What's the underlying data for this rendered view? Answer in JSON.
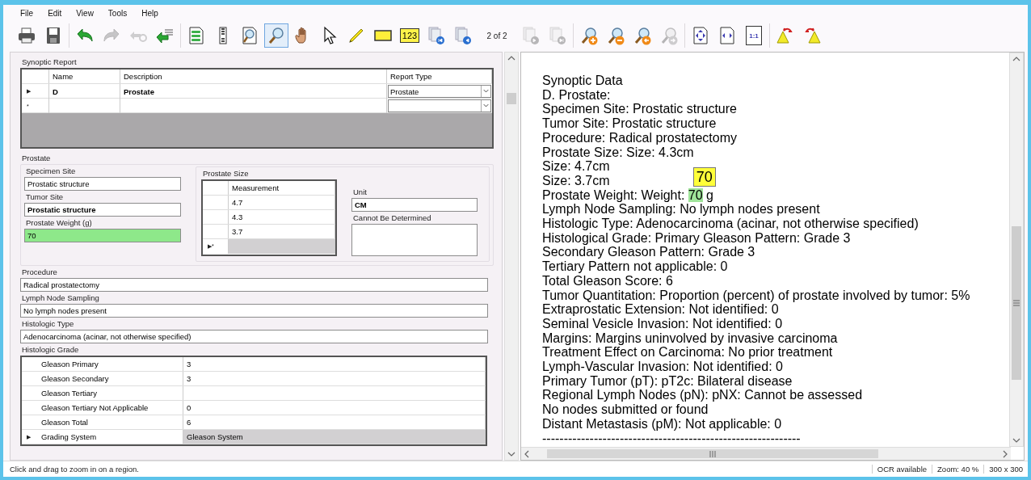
{
  "menu": [
    "File",
    "Edit",
    "View",
    "Tools",
    "Help"
  ],
  "toolbar": {
    "groups": [
      [
        {
          "kind": "print",
          "disabled": false,
          "selected": false
        },
        {
          "kind": "save",
          "disabled": false,
          "selected": false
        }
      ],
      [
        {
          "kind": "undo",
          "disabled": false,
          "selected": false
        },
        {
          "kind": "redo",
          "disabled": true,
          "selected": false
        },
        {
          "kind": "link",
          "disabled": true,
          "selected": false
        },
        {
          "kind": "import",
          "disabled": false,
          "selected": false
        }
      ],
      [
        {
          "kind": "document",
          "disabled": false,
          "selected": false
        },
        {
          "kind": "barcode",
          "disabled": false,
          "selected": false
        },
        {
          "kind": "inspect",
          "disabled": false,
          "selected": false
        },
        {
          "kind": "zoom_tool",
          "disabled": false,
          "selected": true
        },
        {
          "kind": "pan",
          "disabled": false,
          "selected": false
        },
        {
          "kind": "pointer",
          "disabled": false,
          "selected": false
        },
        {
          "kind": "highlighter",
          "disabled": false,
          "selected": false
        },
        {
          "kind": "rectangle",
          "disabled": false,
          "selected": false
        },
        {
          "kind": "number_stamp",
          "label": "123",
          "disabled": false,
          "selected": false
        },
        {
          "kind": "first_page",
          "disabled": false,
          "selected": false
        },
        {
          "kind": "previous_page",
          "disabled": false,
          "selected": false
        },
        {
          "kind": "page_counter",
          "text": "2 of 2"
        },
        {
          "kind": "next_page",
          "disabled": true,
          "selected": false
        },
        {
          "kind": "last_page",
          "disabled": true,
          "selected": false
        }
      ],
      [
        {
          "kind": "zoom_in",
          "disabled": false,
          "selected": false
        },
        {
          "kind": "zoom_out",
          "disabled": false,
          "selected": false
        },
        {
          "kind": "zoom_previous",
          "disabled": false,
          "selected": false
        },
        {
          "kind": "zoom_next",
          "disabled": true,
          "selected": false
        }
      ],
      [
        {
          "kind": "fit_page",
          "disabled": false,
          "selected": false
        },
        {
          "kind": "fit_width",
          "disabled": false,
          "selected": false
        },
        {
          "kind": "actual_size",
          "label": "1:1",
          "disabled": false,
          "selected": false
        }
      ],
      [
        {
          "kind": "rotate_left",
          "disabled": false,
          "selected": false
        },
        {
          "kind": "rotate_right",
          "disabled": false,
          "selected": false
        }
      ]
    ]
  },
  "synoptic_report": {
    "title": "Synoptic Report",
    "columns": [
      "Name",
      "Description",
      "Report Type"
    ],
    "rows": [
      {
        "marker": "▶",
        "bold": true,
        "name": "D",
        "description": "Prostate",
        "report_type": "Prostate"
      },
      {
        "marker": "*"
      }
    ]
  },
  "prostate": {
    "title": "Prostate",
    "fields": [
      {
        "label": "Specimen Site",
        "value": "Prostatic structure",
        "bold": false,
        "highlighted": false
      },
      {
        "label": "Tumor Site",
        "value": "Prostatic structure",
        "bold": true,
        "highlighted": false
      },
      {
        "label": "Prostate Weight (g)",
        "value": "70",
        "bold": false,
        "highlighted": true
      }
    ],
    "size": {
      "title": "Prostate Size",
      "column": "Measurement",
      "rows": [
        "4.7",
        "4.3",
        "3.7"
      ],
      "new_row_marker": "▶*",
      "unit": {
        "label": "Unit",
        "value": "CM"
      },
      "cannot_be_determined": {
        "label": "Cannot Be Determined"
      }
    }
  },
  "fields": [
    {
      "label": "Procedure",
      "value": "Radical prostatectomy"
    },
    {
      "label": "Lymph Node Sampling",
      "value": "No lymph nodes present"
    },
    {
      "label": "Histologic Type",
      "value": "Adenocarcinoma (acinar, not otherwise specified)"
    }
  ],
  "histologic_grade": {
    "title": "Histologic Grade",
    "rows": [
      {
        "name": "Gleason Primary",
        "value": "3",
        "selected": false
      },
      {
        "name": "Gleason Secondary",
        "value": "3",
        "selected": false
      },
      {
        "name": "Gleason Tertiary",
        "selected": false
      },
      {
        "name": "Gleason Tertiary Not Applicable",
        "value": "0",
        "selected": false
      },
      {
        "name": "Gleason Total",
        "value": "6",
        "selected": false
      },
      {
        "marker": "▶",
        "name": "Grading System",
        "value": "Gleason System",
        "selected": true
      }
    ]
  },
  "document": {
    "lines": [
      {
        "text": "Synoptic Data"
      },
      {
        "text": "D. Prostate:"
      },
      {
        "text": "Specimen Site: Prostatic structure"
      },
      {
        "text": "Tumor Site: Prostatic structure"
      },
      {
        "text": "Procedure: Radical prostatectomy"
      },
      {
        "text": "Prostate Size: Size: 4.3cm"
      },
      {
        "text": "Size: 4.7cm"
      },
      {
        "text": "Size: 3.7cm"
      },
      {
        "text": "Prostate Weight: Weight: ",
        "highlighted": "70",
        "after": " g",
        "callout": "70"
      },
      {
        "text": "Lymph Node Sampling: No lymph nodes present"
      },
      {
        "text": "Histologic Type: Adenocarcinoma (acinar, not otherwise specified)"
      },
      {
        "text": "Histological Grade: Primary Gleason Pattern: Grade 3"
      },
      {
        "text": "Secondary Gleason Pattern: Grade 3"
      },
      {
        "text": "Tertiary Pattern not applicable: 0"
      },
      {
        "text": "Total Gleason Score: 6"
      },
      {
        "text": "Tumor Quantitation: Proportion (percent) of prostate involved by tumor: 5%"
      },
      {
        "text": "Extraprostatic Extension: Not identified: 0"
      },
      {
        "text": "Seminal Vesicle Invasion: Not identified: 0"
      },
      {
        "text": "Margins: Margins uninvolved by invasive carcinoma"
      },
      {
        "text": "Treatment Effect on Carcinoma: No prior treatment"
      },
      {
        "text": "Lymph-Vascular Invasion: Not identified: 0"
      },
      {
        "text": "Primary Tumor (pT): pT2c: Bilateral disease"
      },
      {
        "text": "Regional Lymph Nodes (pN): pNX: Cannot be assessed"
      },
      {
        "text": "No nodes submitted or found"
      },
      {
        "text": "Distant Metastasis (pM): Not applicable: 0"
      },
      {
        "text": "------------------------------------------------------------"
      }
    ]
  },
  "status_bar": {
    "message": "Click and drag to zoom in on a region.",
    "panels": [
      "OCR available",
      "Zoom: 40 %",
      "300 x 300"
    ]
  }
}
